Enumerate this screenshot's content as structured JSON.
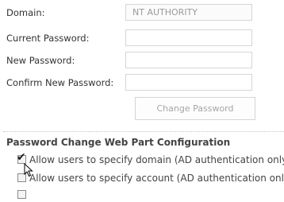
{
  "form": {
    "domain_label": "Domain:",
    "domain_value": "NT AUTHORITY",
    "current_password_label": "Current Password:",
    "current_password_value": "",
    "new_password_label": "New Password:",
    "new_password_value": "",
    "confirm_password_label": "Confirm New Password:",
    "confirm_password_value": "",
    "change_button_label": "Change Password"
  },
  "config": {
    "title": "Password Change Web Part Configuration",
    "options": [
      {
        "label": "Allow users to specify domain (AD authentication only)",
        "checked": true
      },
      {
        "label": "Allow users to specify account (AD authentication only)",
        "checked": false
      }
    ]
  },
  "icons": {
    "checkmark": "check-icon",
    "cursor": "mouse-pointer-icon"
  }
}
